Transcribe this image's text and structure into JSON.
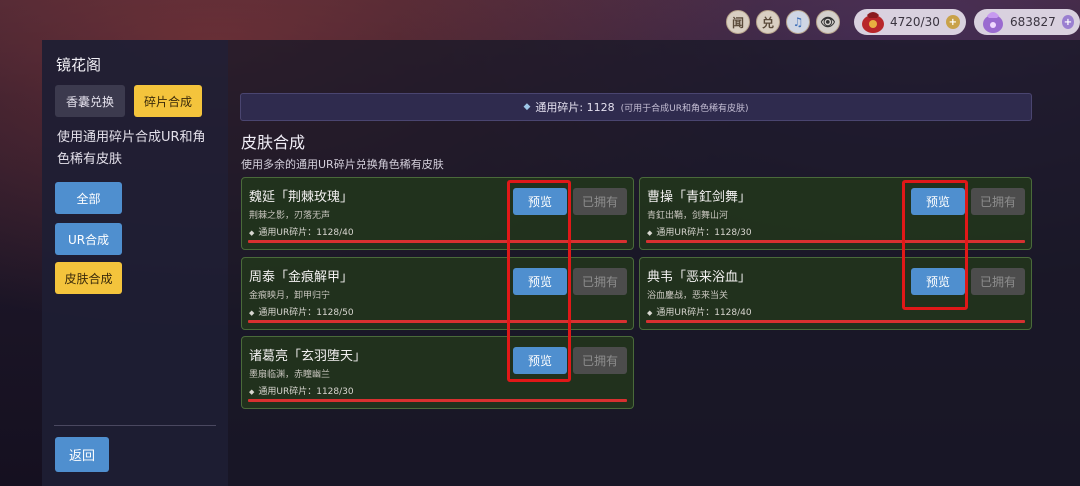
{
  "topbar": {
    "icons": [
      {
        "name": "news-icon",
        "glyph": "闻"
      },
      {
        "name": "redeem-icon",
        "glyph": "兑"
      },
      {
        "name": "music-icon",
        "glyph": "♫"
      },
      {
        "name": "eye-icon",
        "glyph": "👁"
      }
    ],
    "stamina": {
      "icon": "pouch-icon",
      "value": "4720/30",
      "plus": "+"
    },
    "currency": {
      "icon": "gem-bag-icon",
      "value": "683827",
      "plus": "+"
    }
  },
  "sidebar": {
    "title": "镜花阁",
    "tabs": [
      {
        "label": "香囊兑换",
        "active": false
      },
      {
        "label": "碎片合成",
        "active": true
      }
    ],
    "description": "使用通用碎片合成UR和角色稀有皮肤",
    "filters": [
      {
        "label": "全部",
        "active": false
      },
      {
        "label": "UR合成",
        "active": false
      },
      {
        "label": "皮肤合成",
        "active": true
      }
    ],
    "back_label": "返回"
  },
  "main": {
    "shard_bar": {
      "icon": "◆",
      "text": "通用碎片: 1128",
      "note": "(可用于合成UR和角色稀有皮肤)"
    },
    "section_title": "皮肤合成",
    "section_subtitle": "使用多余的通用UR碎片兑换角色稀有皮肤",
    "cards": [
      {
        "name": "魏延「荆棘玫瑰」",
        "desc": "荆棘之影，刃落无声",
        "cost": "通用UR碎片：1128/40",
        "preview": "预览",
        "owned": "已拥有"
      },
      {
        "name": "曹操「青釭剑舞」",
        "desc": "青釭出鞘，剑舞山河",
        "cost": "通用UR碎片：1128/30",
        "preview": "预览",
        "owned": "已拥有"
      },
      {
        "name": "周泰「金痕解甲」",
        "desc": "金痕映月，卸甲归宁",
        "cost": "通用UR碎片：1128/50",
        "preview": "预览",
        "owned": "已拥有"
      },
      {
        "name": "典韦「恶来浴血」",
        "desc": "浴血鏖战，恶来当关",
        "cost": "通用UR碎片：1128/40",
        "preview": "预览",
        "owned": "已拥有"
      },
      {
        "name": "诸葛亮「玄羽堕天」",
        "desc": "墨扇临渊，赤瞳幽兰",
        "cost": "通用UR碎片：1128/30",
        "preview": "预览",
        "owned": "已拥有"
      }
    ],
    "cost_icon": "◆"
  },
  "colors": {
    "accent_blue": "#4f8fcf",
    "accent_yellow": "#f4c43c",
    "highlight_red": "#e01818",
    "card_bg": "#22341c"
  }
}
